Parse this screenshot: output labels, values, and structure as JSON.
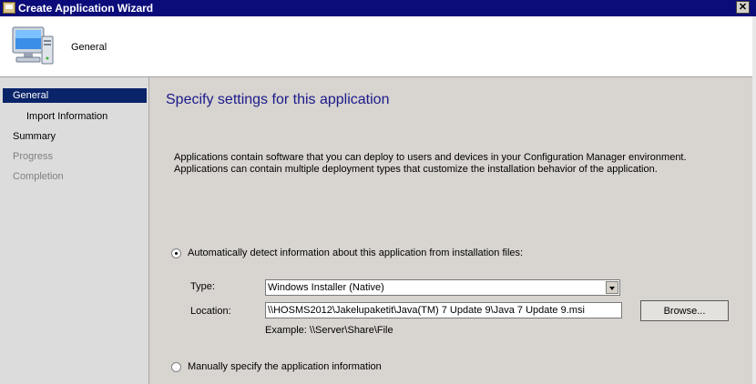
{
  "window": {
    "title": "Create Application Wizard",
    "close_label": "✕"
  },
  "header": {
    "title": "General"
  },
  "sidebar": {
    "items": [
      {
        "label": "General",
        "state": "active"
      },
      {
        "label": "Import Information",
        "state": "sub"
      },
      {
        "label": "Summary",
        "state": "normal"
      },
      {
        "label": "Progress",
        "state": "disabled"
      },
      {
        "label": "Completion",
        "state": "disabled"
      }
    ]
  },
  "main": {
    "heading": "Specify settings for this application",
    "description": "Applications contain software that you can deploy to users and devices in your Configuration Manager environment. Applications can contain multiple deployment types that customize the installation behavior of the application.",
    "auto_detect": {
      "label": "Automatically detect information about this application from installation files:",
      "selected": true
    },
    "type": {
      "label": "Type:",
      "value": "Windows Installer (Native)"
    },
    "location": {
      "label": "Location:",
      "value": "\\\\HOSMS2012\\Jakelupaketit\\Java(TM) 7 Update 9\\Java 7 Update 9.msi",
      "example": "Example: \\\\Server\\Share\\File"
    },
    "browse_label": "Browse...",
    "manual": {
      "label": "Manually specify the application information",
      "selected": false
    }
  },
  "colors": {
    "titlebar": "#0b0b7a",
    "selection": "#0a246a",
    "heading": "#1a1a8a",
    "panel": "#d8d4d0"
  }
}
